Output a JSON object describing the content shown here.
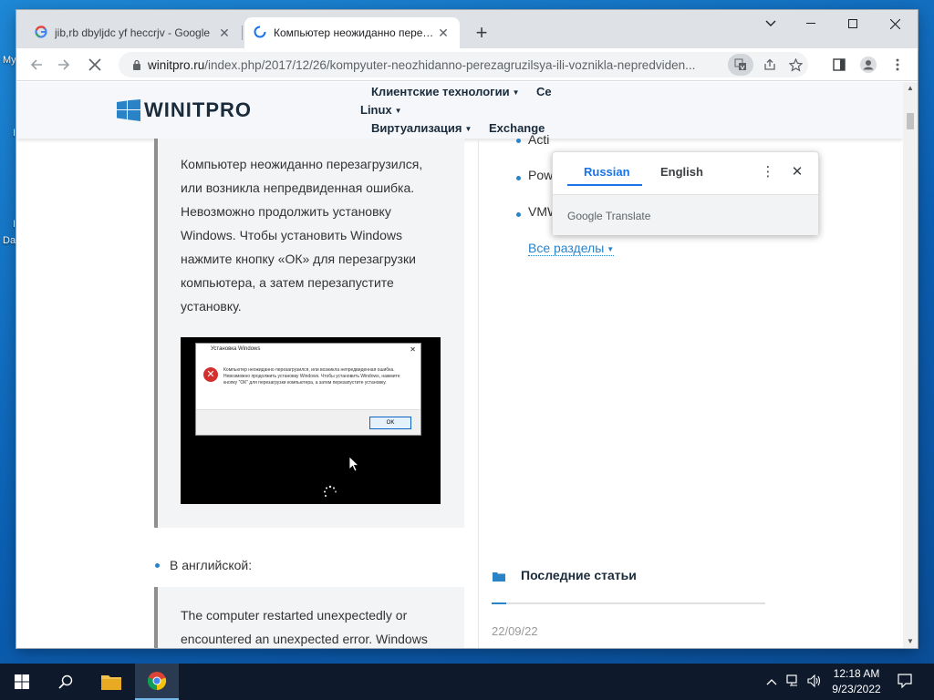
{
  "desktop": {
    "labels": [
      "My",
      "I",
      "I",
      "Da"
    ]
  },
  "browser": {
    "tabs": [
      {
        "title": "jib,rb dbyljdc yf heccrjv - Google",
        "favicon": "google-g-icon",
        "active": false
      },
      {
        "title": "Компьютер неожиданно перезагрузился",
        "favicon": "loading-spinner-icon",
        "active": true
      }
    ],
    "url_host": "winitpro.ru",
    "url_path": "/index.php/2017/12/26/kompyuter-neozhidanno-perezagruzilsya-ili-voznikla-nepredviden..."
  },
  "site": {
    "logo": "WINITPRO",
    "nav": {
      "client_tech": "Клиентские технологии",
      "se_partial": "Се",
      "linux": "Linux",
      "virtualization": "Виртуализация",
      "exchange": "Exchange"
    }
  },
  "article": {
    "ru_quote": [
      "Компьютер неожиданно перезагрузился,",
      "или возникла непредвиденная ошибка.",
      "Невозможно продолжить установку",
      "Windows. Чтобы установить Windows",
      "нажмите кнопку «ОК» для перезагрузки",
      "компьютера, а затем перезапустите",
      "установку."
    ],
    "dialog": {
      "title": "Установка Windows",
      "text": "Компьютер неожиданно перезагрузился, или возникла непредвиденная ошибка. Невозможно продолжить установку Windows. Чтобы установить Windows, нажмите кнопку \"ОК\" для перезагрузки компьютера, а затем перезапустите установку.",
      "ok": "OK"
    },
    "bullet_english": "В английской:",
    "en_quote": [
      "The computer restarted unexpectedly or",
      "encountered an unexpected error. Windows"
    ]
  },
  "sidebar": {
    "items": [
      "Acti",
      "PowerShell",
      "VMWare"
    ],
    "all_sections": "Все разделы",
    "recent_title": "Последние статьи",
    "recent_date": "22/09/22"
  },
  "translate_popup": {
    "lang_from": "Russian",
    "lang_to": "English",
    "brand_google": "Google",
    "brand_translate": "Translate"
  },
  "taskbar": {
    "time": "12:18 AM",
    "date": "9/23/2022"
  },
  "colors": {
    "accent": "#2b83c7",
    "chrome_blue": "#1a73e8"
  }
}
